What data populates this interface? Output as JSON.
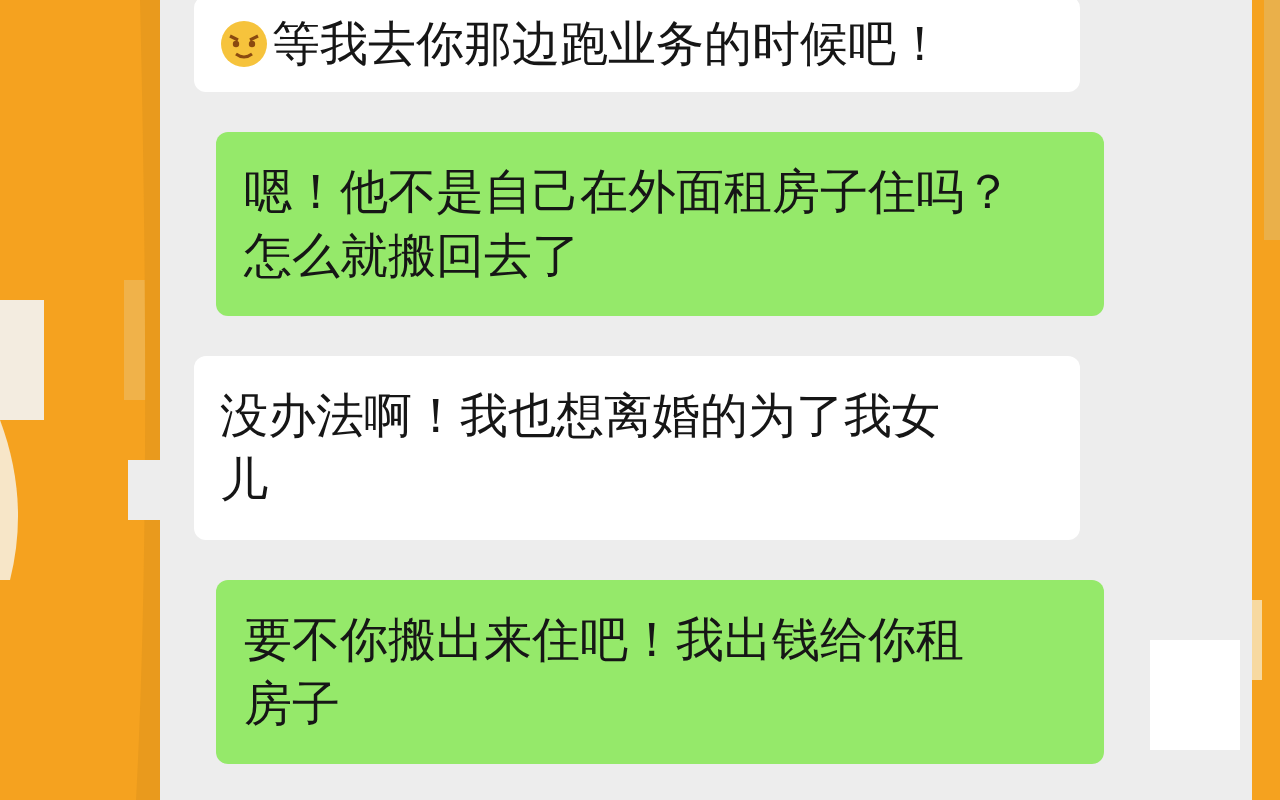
{
  "messages": [
    {
      "kind": "received",
      "leading_emoji": true,
      "lines": [
        "等我去你那边跑业务的时候吧！"
      ]
    },
    {
      "kind": "sent",
      "leading_emoji": false,
      "lines": [
        "嗯！他不是自己在外面租房子住吗？",
        "怎么就搬回去了"
      ]
    },
    {
      "kind": "received",
      "leading_emoji": false,
      "lines": [
        "没办法啊！我也想离婚的为了我女",
        "儿"
      ]
    },
    {
      "kind": "sent",
      "leading_emoji": false,
      "lines": [
        "要不你搬出来住吧！我出钱给你租",
        "房子"
      ]
    }
  ]
}
